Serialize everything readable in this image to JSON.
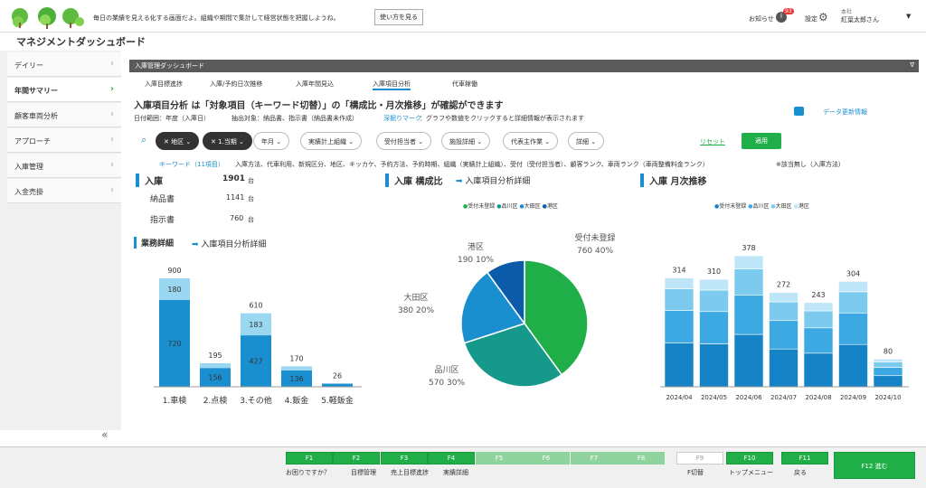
{
  "topbar": {
    "message": "毎日の業績を見える化する画面だよ。組織や期間で集計して経営状態を把握しようね。",
    "howto_button": "使い方を見る",
    "notice_label": "お知らせ",
    "notice_count": "93",
    "settings_label": "設定",
    "user_org": "本社",
    "user_name": "紅葉太郎さん"
  },
  "page_title": "マネジメントダッシュボード",
  "sidebar": {
    "items": [
      {
        "label": "デイリー"
      },
      {
        "label": "年間サマリー"
      },
      {
        "label": "顧客車両分析"
      },
      {
        "label": "アプローチ"
      },
      {
        "label": "入庫管理"
      },
      {
        "label": "入金売掛"
      }
    ],
    "collapse_icon": "«"
  },
  "panel_title": "入庫管理ダッシュボード",
  "tabs": [
    "入庫目標進捗",
    "入庫/予約日次推移",
    "入庫年間見込",
    "入庫項目分析",
    "代車稼働"
  ],
  "headline": "入庫項目分析 は「対象項目（キーワード切替）」の「構成比・月次推移」が確認ができます",
  "date_range": "日付範囲：年度（入庫日）",
  "extract_target": "抽出対象：納品書、指示書（納品書未作成）",
  "drill_label": "深掘りマーク",
  "drill_text": "：グラフや数値をクリックすると詳細情報が表示されます",
  "data_update": "データ更新情報",
  "filters": [
    "地区",
    "1.当期",
    "年月",
    "実績計上組織",
    "受付担当者",
    "施設詳細",
    "代表主作業",
    "詳細"
  ],
  "reset_label": "リセット",
  "apply_label": "適用",
  "keyword_label": "キーワード（11項目）",
  "keyword_list": "入庫方法、代車利用、新規区分、地区、キッカケ、予約方法、予約時期、組織（実績計上組織）、受付（受付担当者）、顧客ランク、車両ランク（車両整備料金ランク）",
  "keyword_note": "※該当無し（入庫方法）",
  "summary": {
    "title": "入庫",
    "total": "1901",
    "unit": "台",
    "rows": [
      {
        "label": "納品書",
        "value": "1141",
        "unit": "台"
      },
      {
        "label": "指示書",
        "value": "760",
        "unit": "台"
      }
    ]
  },
  "detail_title": "業務詳細",
  "detail_link": "入庫項目分析詳細",
  "pie_title": "入庫 構成比",
  "pie_link": "入庫項目分析詳細",
  "monthly_title": "入庫 月次推移",
  "legend": [
    "受付未登録",
    "品川区",
    "大田区",
    "港区"
  ],
  "colors": {
    "green": "#1fae48",
    "blue": "#1a8fd0",
    "teal": "#16988a",
    "navy": "#0b5ba8",
    "dark_blue": "#1583c6",
    "light_blue": "#9ad8f2",
    "pale_blue": "#cdeefb"
  },
  "chart_data": [
    {
      "type": "bar",
      "categories": [
        "1.車検",
        "2.点検",
        "3.その他",
        "4.鈑金",
        "5.軽鈑金"
      ],
      "series": [
        {
          "values": [
            720,
            156,
            427,
            136,
            26
          ]
        },
        {
          "values": [
            180,
            39,
            183,
            34,
            0
          ]
        }
      ],
      "totals": [
        900,
        195,
        610,
        170,
        26
      ],
      "segment_labels": [
        [
          "720",
          "180"
        ],
        [
          "156",
          ""
        ],
        [
          "427",
          "183"
        ],
        [
          "136",
          ""
        ],
        [
          "",
          ""
        ]
      ]
    },
    {
      "type": "pie",
      "labels": [
        "受付未登録",
        "品川区",
        "大田区",
        "港区"
      ],
      "values": [
        760,
        570,
        380,
        190
      ],
      "label_texts": [
        "760 40%",
        "570 30%",
        "380 20%",
        "190 10%"
      ]
    },
    {
      "type": "bar",
      "categories": [
        "2024/04",
        "2024/05",
        "2024/06",
        "2024/07",
        "2024/08",
        "2024/09",
        "2024/10"
      ],
      "totals": [
        314,
        310,
        378,
        272,
        243,
        304,
        80
      ],
      "series": [
        {
          "name": "受付未登録",
          "values": [
            126,
            124,
            151,
            109,
            97,
            122,
            32
          ]
        },
        {
          "name": "品川区",
          "values": [
            94,
            93,
            113,
            82,
            73,
            91,
            24
          ]
        },
        {
          "name": "大田区",
          "values": [
            63,
            62,
            76,
            54,
            49,
            61,
            16
          ]
        },
        {
          "name": "港区",
          "values": [
            31,
            31,
            38,
            27,
            24,
            30,
            8
          ]
        }
      ]
    }
  ],
  "fkeys": [
    {
      "key": "F1",
      "label": "お困りですか？"
    },
    {
      "key": "F2",
      "label": "目標管理"
    },
    {
      "key": "F3",
      "label": "売上目標進捗"
    },
    {
      "key": "F4",
      "label": "実績詳細"
    },
    {
      "key": "F5",
      "label": ""
    },
    {
      "key": "F6",
      "label": ""
    },
    {
      "key": "F7",
      "label": ""
    },
    {
      "key": "F8",
      "label": ""
    },
    {
      "key": "F9",
      "label": "F切替"
    },
    {
      "key": "F10",
      "label": "トップメニュー"
    },
    {
      "key": "F11",
      "label": "戻る"
    },
    {
      "key": "F12 進む",
      "label": ""
    }
  ]
}
